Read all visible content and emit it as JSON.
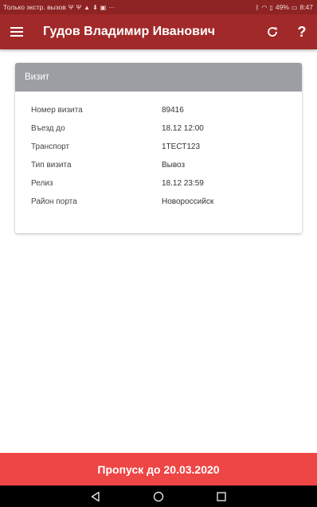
{
  "status_bar": {
    "left_text": "Только экстр. вызов",
    "notification_icons": [
      "usb-icon",
      "usb-icon",
      "bell-icon",
      "download-icon",
      "image-icon",
      "more-icon"
    ],
    "battery": "49%",
    "time": "8:47"
  },
  "app_bar": {
    "title": "Гудов Владимир Иванович",
    "menu_icon": "menu-icon",
    "refresh_icon": "refresh-icon",
    "help_label": "?"
  },
  "card": {
    "header": "Визит",
    "rows": [
      {
        "label": "Номер визита",
        "value": "89416"
      },
      {
        "label": "Въезд до",
        "value": "18.12 12:00"
      },
      {
        "label": "Транспорт",
        "value": "1ТЕСТ123"
      },
      {
        "label": "Тип визита",
        "value": "Вывоз"
      },
      {
        "label": "Релиз",
        "value": "18.12 23:59"
      },
      {
        "label": "Район порта",
        "value": "Новороссийск"
      }
    ]
  },
  "pass_button": {
    "label": "Пропуск до 20.03.2020"
  },
  "colors": {
    "status_bar": "#8e2323",
    "app_bar": "#a22929",
    "card_header": "#9c9ea3",
    "pass_button": "#ee4545"
  }
}
